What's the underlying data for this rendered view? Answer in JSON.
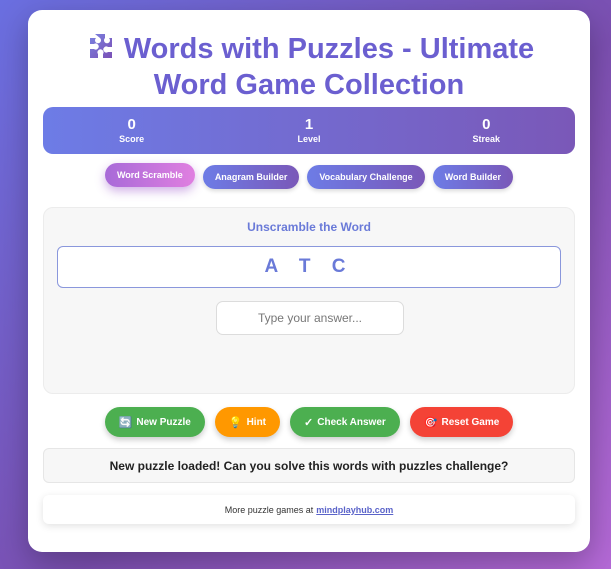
{
  "header": {
    "title": "Words with Puzzles - Ultimate Word Game Collection",
    "icon": "puzzle-piece-icon"
  },
  "stats": [
    {
      "value": "0",
      "label": "Score"
    },
    {
      "value": "1",
      "label": "Level"
    },
    {
      "value": "0",
      "label": "Streak"
    }
  ],
  "tabs": [
    {
      "label": "Word Scramble",
      "active": true
    },
    {
      "label": "Anagram Builder",
      "active": false
    },
    {
      "label": "Vocabulary Challenge",
      "active": false
    },
    {
      "label": "Word Builder",
      "active": false
    }
  ],
  "game": {
    "heading": "Unscramble the Word",
    "scrambled_word": "A T C",
    "answer_value": "",
    "answer_placeholder": "Type your answer..."
  },
  "actions": [
    {
      "label": "New Puzzle",
      "icon": "refresh-icon",
      "color": "#4caf50"
    },
    {
      "label": "Hint",
      "icon": "lightbulb-icon",
      "color": "#ff9800"
    },
    {
      "label": "Check Answer",
      "icon": "check-icon",
      "color": "#4caf50"
    },
    {
      "label": "Reset Game",
      "icon": "target-icon",
      "color": "#f44336"
    }
  ],
  "status_message": "New puzzle loaded! Can you solve this words with puzzles challenge?",
  "footer": {
    "text": "More puzzle games at",
    "link_text": "mindplayhub.com"
  },
  "colors": {
    "accent": "#6a7ad8",
    "active_tab": "#d67ae0",
    "green": "#4caf50",
    "orange": "#ff9800",
    "red": "#f44336"
  }
}
